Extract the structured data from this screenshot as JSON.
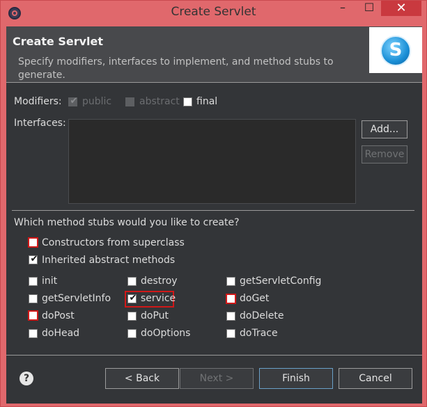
{
  "window": {
    "title": "Create Servlet",
    "controls": {
      "minimize": "–",
      "maximize": "☐",
      "close": "✕"
    }
  },
  "header": {
    "title": "Create Servlet",
    "description": "Specify modifiers, interfaces to implement, and method stubs to generate.",
    "logo_letter": "S"
  },
  "modifiers": {
    "label": "Modifiers:",
    "public": {
      "label": "public",
      "checked": true,
      "enabled": false
    },
    "abstract": {
      "label": "abstract",
      "checked": false,
      "enabled": false
    },
    "final": {
      "label": "final",
      "checked": false,
      "enabled": true
    }
  },
  "interfaces": {
    "label": "Interfaces:",
    "add_button": "Add...",
    "remove_button": "Remove"
  },
  "stubs": {
    "question": "Which method stubs would you like to create?",
    "constructors": {
      "label": "Constructors from superclass",
      "checked": false
    },
    "inherited": {
      "label": "Inherited abstract methods",
      "checked": true
    },
    "methods": [
      {
        "label": "init",
        "checked": false
      },
      {
        "label": "destroy",
        "checked": false
      },
      {
        "label": "getServletConfig",
        "checked": false
      },
      {
        "label": "getServletInfo",
        "checked": false
      },
      {
        "label": "service",
        "checked": true
      },
      {
        "label": "doGet",
        "checked": false
      },
      {
        "label": "doPost",
        "checked": false
      },
      {
        "label": "doPut",
        "checked": false
      },
      {
        "label": "doDelete",
        "checked": false
      },
      {
        "label": "doHead",
        "checked": false
      },
      {
        "label": "doOptions",
        "checked": false
      },
      {
        "label": "doTrace",
        "checked": false
      }
    ]
  },
  "footer": {
    "help": "?",
    "back_button": "< Back",
    "next_button": "Next >",
    "finish_button": "Finish",
    "cancel_button": "Cancel"
  },
  "colors": {
    "titlebar": "#e0686c",
    "close": "#c9393f",
    "body": "#333538",
    "highlight": "#d01818"
  }
}
